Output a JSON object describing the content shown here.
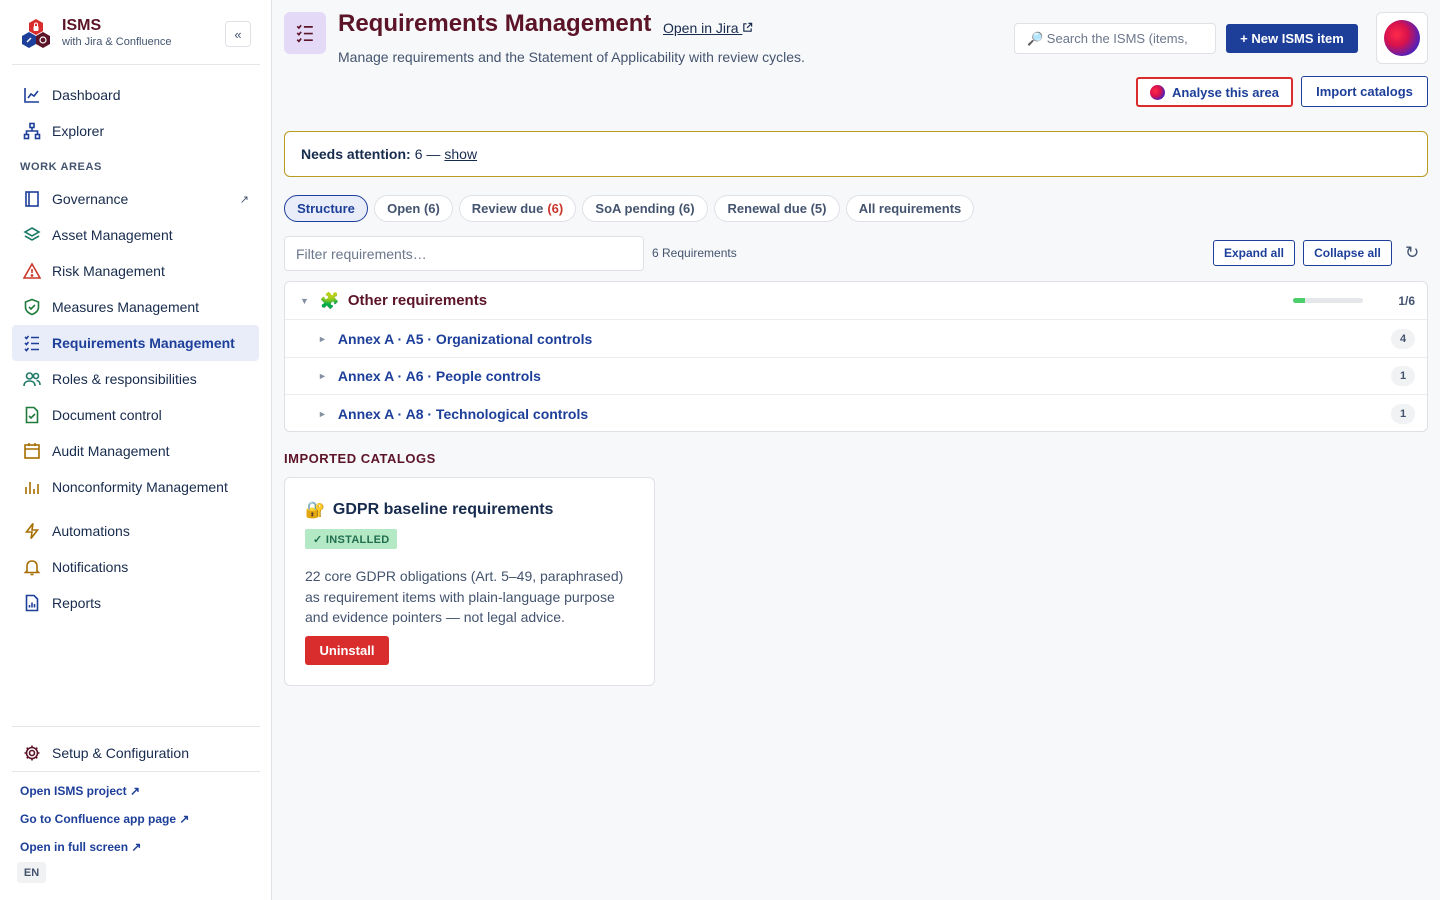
{
  "brand": {
    "name": "ISMS",
    "subtitle": "with Jira & Confluence",
    "collapse_label": "«"
  },
  "sidebar": {
    "top_items": [
      {
        "label": "Dashboard",
        "icon": "chart-line-icon"
      },
      {
        "label": "Explorer",
        "icon": "hierarchy-icon"
      }
    ],
    "section_label": "WORK AREAS",
    "work_items": [
      {
        "label": "Governance",
        "icon": "book-icon",
        "external": "↗"
      },
      {
        "label": "Asset Management",
        "icon": "layers-icon"
      },
      {
        "label": "Risk Management",
        "icon": "warning-triangle-icon"
      },
      {
        "label": "Measures Management",
        "icon": "shield-check-icon"
      },
      {
        "label": "Requirements Management",
        "icon": "checklist-icon",
        "active": true
      },
      {
        "label": "Roles & responsibilities",
        "icon": "users-icon"
      },
      {
        "label": "Document control",
        "icon": "document-check-icon"
      },
      {
        "label": "Audit Management",
        "icon": "calendar-icon"
      },
      {
        "label": "Nonconformity Management",
        "icon": "bar-chart-icon"
      }
    ],
    "extra_items": [
      {
        "label": "Automations",
        "icon": "lightning-icon"
      },
      {
        "label": "Notifications",
        "icon": "bell-icon"
      },
      {
        "label": "Reports",
        "icon": "report-icon"
      }
    ],
    "setup": {
      "label": "Setup & Configuration",
      "icon": "gear-icon"
    },
    "links": [
      {
        "label": "Open ISMS project ↗"
      },
      {
        "label": "Go to Confluence app page ↗"
      },
      {
        "label": "Open in full screen ↗"
      }
    ],
    "language": "EN"
  },
  "header": {
    "title": "Requirements Management",
    "jira_link": "Open in Jira",
    "description": "Manage requirements and the Statement of Applicability with review cycles.",
    "search_placeholder": "🔎 Search the ISMS (items,",
    "new_item_label": "+ New ISMS item",
    "analyse_label": "Analyse this area",
    "import_label": "Import catalogs"
  },
  "attention": {
    "label": "Needs attention:",
    "value": "6 —",
    "link": "show"
  },
  "tabs": [
    {
      "label": "Structure",
      "active": true
    },
    {
      "label": "Open (6)"
    },
    {
      "label": "Review due",
      "badge": "(6)"
    },
    {
      "label": "SoA pending (6)"
    },
    {
      "label": "Renewal due (5)"
    },
    {
      "label": "All requirements"
    }
  ],
  "filter": {
    "placeholder": "Filter requirements…",
    "count": "6 Requirements",
    "expand_label": "Expand all",
    "collapse_label": "Collapse all"
  },
  "tree": {
    "group": {
      "title": "Other requirements",
      "icon": "puzzle-icon",
      "progress_fraction": 0.1667,
      "progress_label": "1/6",
      "caret": "▼"
    },
    "children": [
      {
        "title": "Annex A · A5 · Organizational controls",
        "count": "4",
        "caret": "►"
      },
      {
        "title": "Annex A · A6 · People controls",
        "count": "1",
        "caret": "►"
      },
      {
        "title": "Annex A · A8 · Technological controls",
        "count": "1",
        "caret": "►"
      }
    ]
  },
  "catalogs": {
    "heading": "IMPORTED CATALOGS",
    "card": {
      "title": "GDPR baseline requirements",
      "icon": "🔐",
      "status": "✓ INSTALLED",
      "description": "22 core GDPR obligations (Art. 5–49, paraphrased) as requirement items with plain-language purpose and evidence pointers — not legal advice.",
      "action": "Uninstall"
    }
  },
  "colors": {
    "brand_maroon": "#5c1428",
    "primary_blue": "#1d3f9a",
    "danger_red": "#d92c2c",
    "attention_border": "#b89b1f",
    "success_green": "#4bce6b"
  }
}
